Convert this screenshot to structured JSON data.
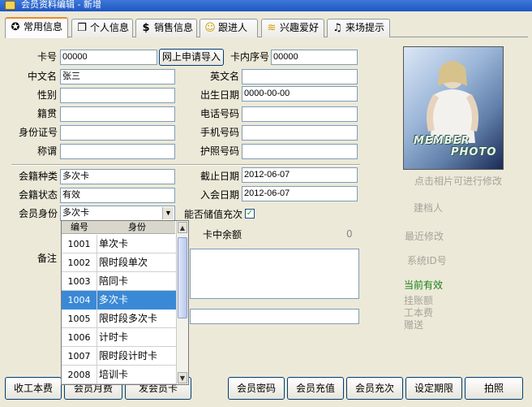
{
  "window": {
    "title": "会员资料编辑 - 新增"
  },
  "tabs": [
    {
      "label": "常用信息",
      "icon": "id-card-icon"
    },
    {
      "label": "个人信息",
      "icon": "windows-icon"
    },
    {
      "label": "销售信息",
      "icon": "dollar-icon"
    },
    {
      "label": "跟进人",
      "icon": "smiley-icon"
    },
    {
      "label": "兴趣爱好",
      "icon": "sound-wave-icon"
    },
    {
      "label": "来场提示",
      "icon": "speaker-icon"
    }
  ],
  "form": {
    "card_no": {
      "label": "卡号",
      "value": "00000"
    },
    "online_import_button": "网上申请导入",
    "inner_no": {
      "label": "卡内序号",
      "value": "00000"
    },
    "cn_name": {
      "label": "中文名",
      "value": "张三"
    },
    "en_name": {
      "label": "英文名",
      "value": ""
    },
    "gender": {
      "label": "性别",
      "value": ""
    },
    "birthday": {
      "label": "出生日期",
      "value": "0000-00-00"
    },
    "native_place": {
      "label": "籍贯",
      "value": ""
    },
    "phone": {
      "label": "电话号码",
      "value": ""
    },
    "id_no": {
      "label": "身份证号",
      "value": ""
    },
    "mobile": {
      "label": "手机号码",
      "value": ""
    },
    "title": {
      "label": "称谓",
      "value": ""
    },
    "passport": {
      "label": "护照号码",
      "value": ""
    },
    "membership_type": {
      "label": "会籍种类",
      "value": "多次卡"
    },
    "expiry": {
      "label": "截止日期",
      "value": "2012-06-07"
    },
    "membership_status": {
      "label": "会籍状态",
      "value": "有效"
    },
    "join_date": {
      "label": "入会日期",
      "value": "2012-06-07"
    },
    "member_identity": {
      "label": "会员身份",
      "value": "多次卡"
    },
    "stored_value": {
      "label": "能否储值充次",
      "checked": true,
      "check_glyph": "✓"
    },
    "card_balance": {
      "label": "卡中余额",
      "value": "0"
    },
    "remarks": {
      "label": "备注"
    }
  },
  "dropdown": {
    "headers": {
      "code": "编号",
      "name": "身份"
    },
    "selected_index": 3,
    "items": [
      {
        "code": "1001",
        "name": "单次卡"
      },
      {
        "code": "1002",
        "name": "限时段单次"
      },
      {
        "code": "1003",
        "name": "陪同卡"
      },
      {
        "code": "1004",
        "name": "多次卡"
      },
      {
        "code": "1005",
        "name": "限时段多次卡"
      },
      {
        "code": "1006",
        "name": "计时卡"
      },
      {
        "code": "1007",
        "name": "限时段计时卡"
      },
      {
        "code": "2008",
        "name": "培训卡"
      }
    ]
  },
  "photo": {
    "watermark_line1": "MEMBER",
    "watermark_line2": "PHOTO",
    "hint": "点击相片可进行修改"
  },
  "side_info": {
    "creator_label": "建档人",
    "recent_modify_label": "最近修改",
    "system_id_label": "系统ID号",
    "current_status": "当前有效",
    "on_account_label": "挂账额",
    "fee_label": "工本费",
    "gift_label": "赠送"
  },
  "buttons": {
    "fee": "收工本费",
    "monthly_fee": "会员月费",
    "issue_card": "发会员卡",
    "password": "会员密码",
    "recharge": "会员充值",
    "recharge_count": "会员充次",
    "set_period": "设定期限",
    "photo": "拍照"
  },
  "colors": {
    "title_bar": "#1f56c4",
    "selection": "#3a89d6",
    "status_valid": "#1a7f1a",
    "active_tab_accent": "#e68b2c"
  }
}
